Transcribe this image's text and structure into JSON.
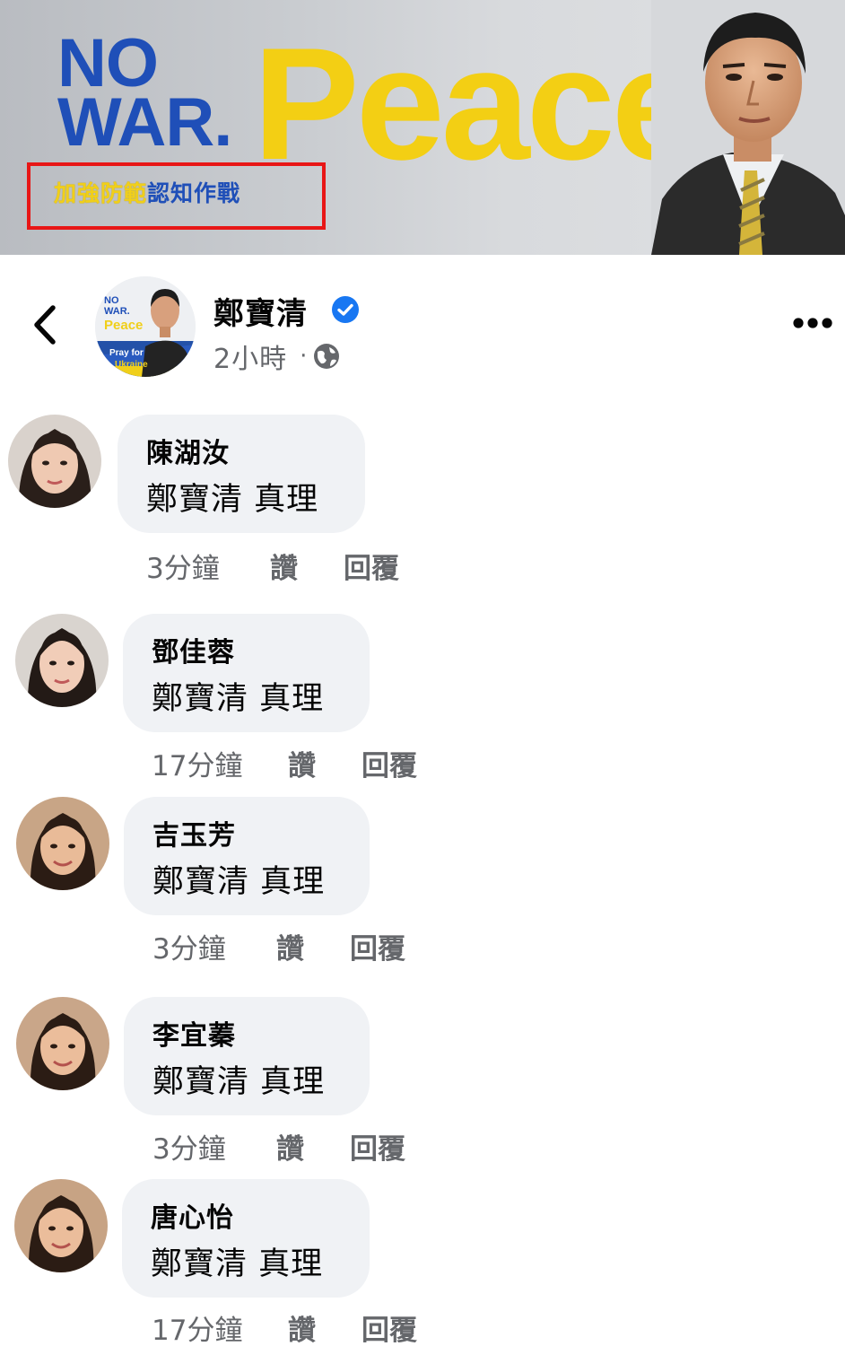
{
  "banner": {
    "nowar_line1": "NO",
    "nowar_line2": "WAR.",
    "peace": "Peace",
    "slogan_yellow": "加強防範",
    "slogan_blue": "認知作戰",
    "colors": {
      "blue": "#1f4fb8",
      "yellow": "#f3cf14",
      "highlight_box": "#e81616"
    }
  },
  "post": {
    "author": "鄭寶清",
    "verified": true,
    "time": "2小時",
    "separator": "·",
    "privacy_icon": "globe-icon",
    "avatar_text": {
      "no": "NO",
      "war": "WAR.",
      "peace": "Peace",
      "pray": "Pray for",
      "ukraine": "Ukraine"
    }
  },
  "comments": [
    {
      "author": "陳湖汝",
      "text": "鄭寶清 真理",
      "time": "3分鐘",
      "like": "讚",
      "reply": "回覆"
    },
    {
      "author": "鄧佳蓉",
      "text": "鄭寶清 真理",
      "time": "17分鐘",
      "like": "讚",
      "reply": "回覆"
    },
    {
      "author": "吉玉芳",
      "text": "鄭寶清 真理",
      "time": "3分鐘",
      "like": "讚",
      "reply": "回覆"
    },
    {
      "author": "李宜蓁",
      "text": "鄭寶清 真理",
      "time": "3分鐘",
      "like": "讚",
      "reply": "回覆"
    },
    {
      "author": "唐心怡",
      "text": "鄭寶清 真理",
      "time": "17分鐘",
      "like": "讚",
      "reply": "回覆"
    }
  ],
  "theme": {
    "bubble": "#f0f2f5",
    "secondary_text": "#65676b",
    "verified": "#1877f2"
  }
}
